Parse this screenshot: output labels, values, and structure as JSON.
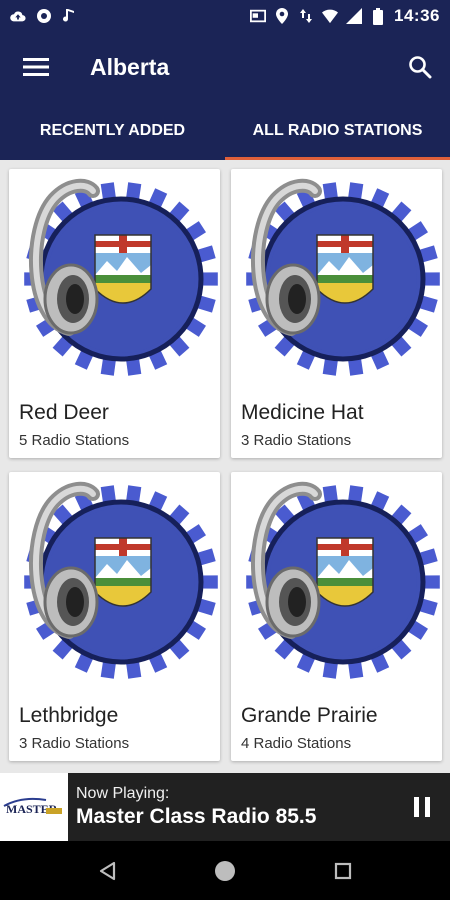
{
  "status_bar": {
    "time": "14:36",
    "icons": [
      "cloud-upload-icon",
      "settings-icon",
      "music-note-icon",
      "cast-icon",
      "location-icon",
      "data-arrows-icon",
      "wifi-icon",
      "signal-icon",
      "battery-icon"
    ]
  },
  "app_bar": {
    "title": "Alberta",
    "menu_icon": "hamburger-menu-icon",
    "search_icon": "search-icon"
  },
  "tabs": [
    {
      "label": "RECENTLY ADDED",
      "active": false
    },
    {
      "label": "ALL RADIO STATIONS",
      "active": true
    }
  ],
  "cities": [
    {
      "name": "Red Deer",
      "count": "5 Radio Stations"
    },
    {
      "name": "Medicine Hat",
      "count": "3 Radio Stations"
    },
    {
      "name": "Lethbridge",
      "count": "3 Radio Stations"
    },
    {
      "name": "Grande Prairie",
      "count": "4 Radio Stations"
    }
  ],
  "now_playing": {
    "label": "Now Playing:",
    "station": "Master Class Radio 85.5",
    "logo_text": "MASTER",
    "control_icon": "pause-icon"
  },
  "nav": [
    "back-icon",
    "home-icon",
    "recents-icon"
  ],
  "colors": {
    "primary": "#1b2456",
    "accent": "#e0603a",
    "badge_blue": "#3f51b5",
    "badge_ray": "#4a5bd0"
  }
}
